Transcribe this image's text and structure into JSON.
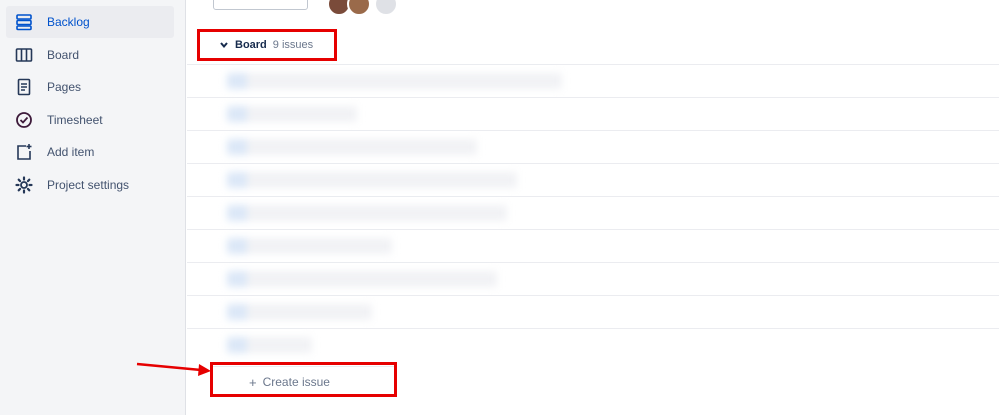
{
  "sidebar": {
    "items": [
      {
        "label": "Backlog",
        "icon": "backlog-icon",
        "active": true
      },
      {
        "label": "Board",
        "icon": "board-icon",
        "active": false
      },
      {
        "label": "Pages",
        "icon": "pages-icon",
        "active": false
      },
      {
        "label": "Timesheet",
        "icon": "timesheet-icon",
        "active": false
      },
      {
        "label": "Add item",
        "icon": "add-item-icon",
        "active": false
      },
      {
        "label": "Project settings",
        "icon": "gear-icon",
        "active": false
      }
    ]
  },
  "section": {
    "title": "Board",
    "issue_count": "9 issues"
  },
  "create_issue": {
    "plus": "+",
    "label": "Create issue"
  },
  "colors": {
    "accent": "#0052cc",
    "annotation": "#e60000"
  }
}
